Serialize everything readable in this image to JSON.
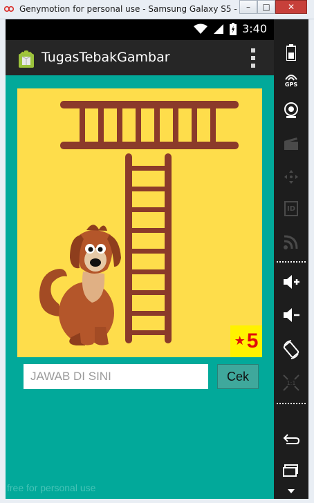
{
  "window": {
    "title": "Genymotion for personal use - Samsung Galaxy S5 - 4.4.4...",
    "min_label": "–",
    "max_label": "□",
    "close_label": "✕"
  },
  "statusbar": {
    "time": "3:40"
  },
  "actionbar": {
    "title": "TugasTebakGambar"
  },
  "quiz": {
    "badge_star": "★",
    "badge_number": "5",
    "answer_placeholder": "JAWAB DI SINI",
    "check_label": "Cek"
  },
  "watermark": "free for personal use",
  "sidepanel": {
    "gps_label": "GPS",
    "id_label": "ID"
  },
  "colors": {
    "screen_bg": "#02a99a",
    "picture_bg": "#fedd4b",
    "ladder": "#8b3a2a",
    "badge_bg": "#fff200",
    "badge_text": "#e10b0b"
  }
}
